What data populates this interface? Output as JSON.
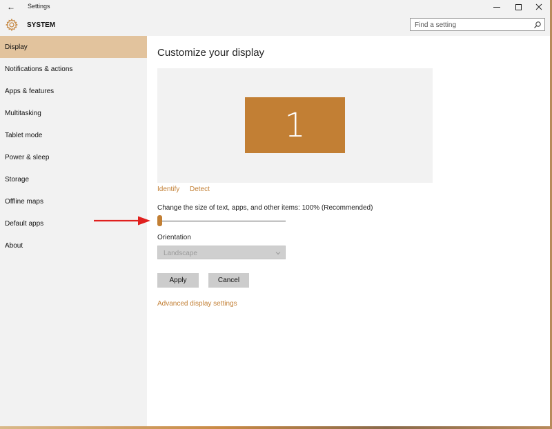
{
  "window": {
    "title": "Settings"
  },
  "header": {
    "section": "SYSTEM",
    "search_placeholder": "Find a setting"
  },
  "sidebar": {
    "items": [
      {
        "label": "Display",
        "active": true
      },
      {
        "label": "Notifications & actions"
      },
      {
        "label": "Apps & features"
      },
      {
        "label": "Multitasking"
      },
      {
        "label": "Tablet mode"
      },
      {
        "label": "Power & sleep"
      },
      {
        "label": "Storage"
      },
      {
        "label": "Offline maps"
      },
      {
        "label": "Default apps"
      },
      {
        "label": "About"
      }
    ]
  },
  "main": {
    "title": "Customize your display",
    "monitor_number": "1",
    "identify_link": "Identify",
    "detect_link": "Detect",
    "scale_label": "Change the size of text, apps, and other items: 100% (Recommended)",
    "scale_value_fraction": 0,
    "orientation_label": "Orientation",
    "orientation_value": "Landscape",
    "apply_label": "Apply",
    "cancel_label": "Cancel",
    "advanced_link": "Advanced display settings"
  },
  "colors": {
    "accent": "#c27f34",
    "selected_bg": "#e2c39d",
    "annotation_arrow": "#e0201e"
  },
  "icons": [
    "back-arrow-icon",
    "gear-icon",
    "search-icon",
    "chevron-down-icon",
    "minimize-icon",
    "maximize-icon",
    "close-icon"
  ]
}
